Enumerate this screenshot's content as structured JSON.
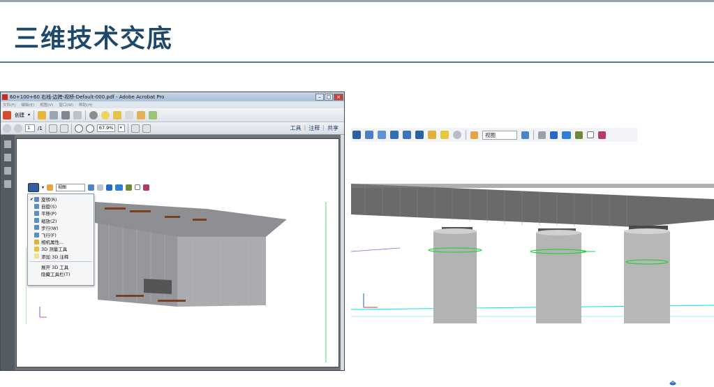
{
  "slide": {
    "title": "三维技术交底"
  },
  "acrobat": {
    "window_title": "60+100+60 右线-边跨-视桥-Default-000.pdf - Adobe Acrobat Pro",
    "win_buttons": [
      "–",
      "□",
      "×"
    ],
    "menu": [
      "文件(F)",
      "编辑(E)",
      "视图(V)",
      "窗口(W)",
      "帮助(H)"
    ],
    "create_label": "创建",
    "page_current": "1",
    "page_total": "/1",
    "zoom_value": "67.9%",
    "right_links": [
      "工具",
      "注释",
      "共享"
    ]
  },
  "toolbar3d_inner": {
    "view_select": "视图"
  },
  "menu3d": {
    "items": [
      {
        "label": "旋转(R)",
        "checked": true
      },
      {
        "label": "自旋(S)",
        "checked": false
      },
      {
        "label": "平移(P)",
        "checked": false
      },
      {
        "label": "缩放(Z)",
        "checked": false
      },
      {
        "label": "步行(W)",
        "checked": false
      },
      {
        "label": "飞行(F)",
        "checked": false
      },
      {
        "label": "相机属性...",
        "checked": false
      },
      {
        "label": "3D 测量工具",
        "checked": false
      },
      {
        "label": "添加 3D 注释",
        "checked": false
      }
    ],
    "items_bottom": [
      "展开 3D 工具",
      "隐藏工具栏(T)"
    ]
  },
  "toolbar3d_big": {
    "view_select": "视图"
  },
  "colors": {
    "title": "#1e4869",
    "rule": "#4e7f95",
    "pier": "#b8b8b8",
    "deck": "#6a6a6a",
    "cyan_line": "#00e5ee",
    "green_line": "#2ecc40"
  }
}
